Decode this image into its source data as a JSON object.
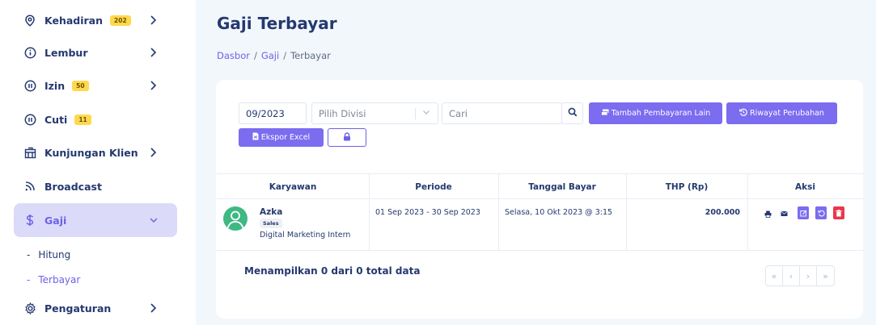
{
  "sidebar": {
    "items": [
      {
        "label": "Kehadiran",
        "badge": "202",
        "icon": "map-pin-icon",
        "has_chevron": true
      },
      {
        "label": "Lembur",
        "icon": "info-icon",
        "has_chevron": true
      },
      {
        "label": "Izin",
        "badge": "50",
        "icon": "pause-circle-icon",
        "has_chevron": true
      },
      {
        "label": "Cuti",
        "badge": "11",
        "icon": "pause-circle-icon",
        "has_chevron": false
      },
      {
        "label": "Kunjungan Klien",
        "icon": "building-icon",
        "has_chevron": true
      },
      {
        "label": "Broadcast",
        "icon": "rss-icon",
        "has_chevron": false
      },
      {
        "label": "Gaji",
        "icon": "dollar-icon",
        "has_chevron": true,
        "active": true
      },
      {
        "label": "Pengaturan",
        "icon": "gear-icon",
        "has_chevron": true
      }
    ],
    "sub_items": [
      {
        "dash": "-",
        "label": "Hitung"
      },
      {
        "dash": "-",
        "label": "Terbayar",
        "active": true
      }
    ]
  },
  "page": {
    "title": "Gaji Terbayar",
    "breadcrumb": [
      "Dasbor",
      "Gaji",
      "Terbayar"
    ],
    "breadcrumb_sep": "/"
  },
  "filters": {
    "period_value": "09/2023",
    "division_placeholder": "Pilih Divisi",
    "search_placeholder": "Cari",
    "add_payment_label": "Tambah Pembayaran Lain",
    "history_label": "Riwayat Perubahan",
    "export_label": "Ekspor Excel"
  },
  "table": {
    "columns": [
      "Karyawan",
      "Periode",
      "Tanggal Bayar",
      "THP (Rp)",
      "Aksi"
    ],
    "rows": [
      {
        "name": "Azka",
        "division": "Sales",
        "position": "Digital Marketing Intern",
        "period": "01 Sep 2023 - 30 Sep 2023",
        "paid_date": "Selasa, 10 Okt 2023 @ 3:15",
        "thp": "200.000"
      }
    ]
  },
  "footer": {
    "showing": "Menampilkan 0 dari 0 total data",
    "pager": [
      "«",
      "‹",
      "›",
      "»"
    ]
  },
  "colors": {
    "accent": "#7b6cf0",
    "active_bg": "#dcdaf9",
    "danger": "#e8394b",
    "badge": "#ffd84d",
    "avatar": "#3fb884"
  }
}
